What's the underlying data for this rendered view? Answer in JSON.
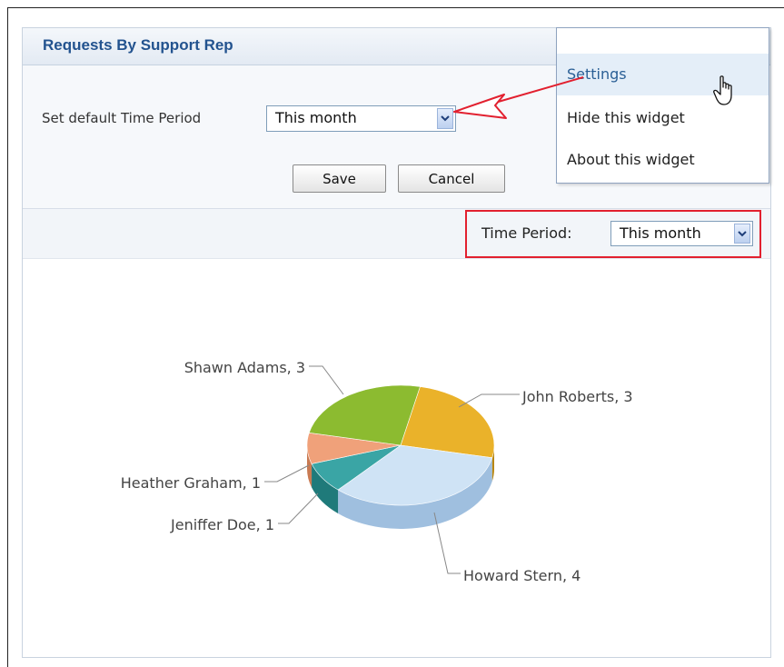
{
  "widget": {
    "title": "Requests By Support Rep",
    "settings": {
      "default_time_label": "Set default Time Period",
      "default_time_value": "This month",
      "save_label": "Save",
      "cancel_label": "Cancel"
    },
    "filter": {
      "label": "Time Period:",
      "value": "This month"
    }
  },
  "gear_menu": {
    "items": [
      {
        "label": "Settings"
      },
      {
        "label": "Hide this widget"
      },
      {
        "label": "About this widget"
      }
    ]
  },
  "icons": {
    "gear": "gear-icon",
    "dropdown": "chevron-down-icon",
    "cursor": "hand-pointer-icon",
    "annotation_arrow": "arrow-left-icon"
  },
  "colors": {
    "title": "#23538f",
    "highlight_box": "#e2202f",
    "slice_howard": "#cfe3f5",
    "slice_john": "#eab22a",
    "slice_shawn": "#8cbb30",
    "slice_heather": "#f0a17a",
    "slice_jeniffer": "#3aa5a5"
  },
  "chart_data": {
    "type": "pie",
    "slices": [
      {
        "name": "John Roberts",
        "value": 3,
        "label": "John Roberts, 3"
      },
      {
        "name": "Howard Stern",
        "value": 4,
        "label": "Howard Stern, 4"
      },
      {
        "name": "Jeniffer Doe",
        "value": 1,
        "label": "Jeniffer Doe, 1"
      },
      {
        "name": "Heather Graham",
        "value": 1,
        "label": "Heather Graham, 1"
      },
      {
        "name": "Shawn Adams",
        "value": 3,
        "label": "Shawn Adams, 3"
      }
    ]
  }
}
